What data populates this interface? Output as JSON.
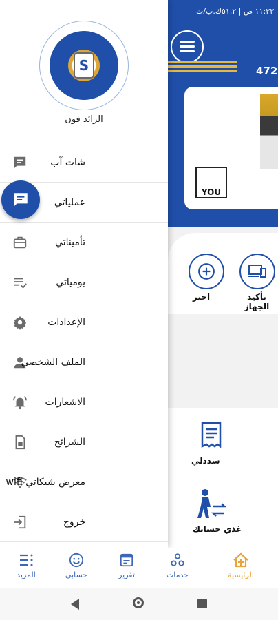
{
  "status_bar": {
    "time_text": "١١:٣٣ ص | ٥١,٢ك.ب/ث"
  },
  "header": {
    "balance": "472,"
  },
  "promo": {
    "badge_text": "YOU"
  },
  "quick_actions": [
    {
      "label": "اختر",
      "icon": "plus-circle-icon"
    },
    {
      "label": "تأكيد الجهاز",
      "icon": "device-icon"
    }
  ],
  "services": [
    {
      "label": "سددلي",
      "icon": "receipt-icon"
    },
    {
      "label": "غذي حسابك",
      "icon": "transfer-person-icon"
    }
  ],
  "drawer": {
    "app_name": "الرائد فون",
    "menu": [
      {
        "label": "شات آب",
        "icon": "chat-icon",
        "active": false
      },
      {
        "label": "عملياتي",
        "icon": "chat-icon",
        "active": true
      },
      {
        "label": "تأميناتي",
        "icon": "briefcase-icon",
        "active": false
      },
      {
        "label": "يومياتي",
        "icon": "list-check-icon",
        "active": false
      },
      {
        "label": "الإعدادات",
        "icon": "gear-icon",
        "active": false
      },
      {
        "label": "الملف الشخصي",
        "icon": "person-icon",
        "active": false
      },
      {
        "label": "الاشعارات",
        "icon": "bell-icon",
        "active": false
      },
      {
        "label": "الشرائح",
        "icon": "sim-icon",
        "active": false
      },
      {
        "label": "معرض شبكاتي wifi",
        "icon": "wifi-icon",
        "active": false
      },
      {
        "label": "خروج",
        "icon": "logout-icon",
        "active": false
      }
    ]
  },
  "bottom_nav": [
    {
      "label": "المزيد",
      "icon": "more-icon"
    },
    {
      "label": "حسابي",
      "icon": "smiley-icon"
    },
    {
      "label": "تقرير",
      "icon": "report-icon"
    },
    {
      "label": "خدمات",
      "icon": "services-icon"
    },
    {
      "label": "الرئيسية",
      "icon": "home-icon",
      "active": true
    }
  ],
  "colors": {
    "brand_blue": "#1f4fa9",
    "accent_gold": "#e8b83a",
    "active_nav": "#e8a33a"
  }
}
